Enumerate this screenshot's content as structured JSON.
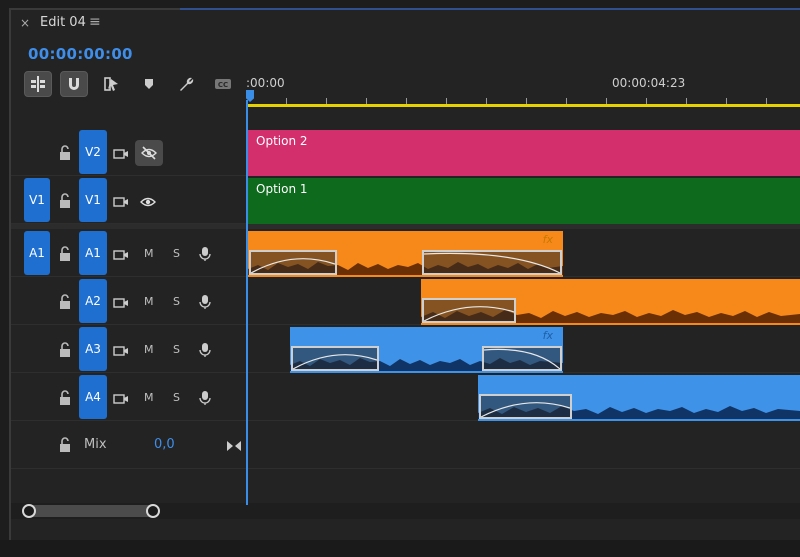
{
  "tab": {
    "close_glyph": "×",
    "title": "Edit 04",
    "menu_glyph": "≡"
  },
  "timecode": "00:00:00:00",
  "toolbar": [
    {
      "name": "insert-sequence-as-nest-icon"
    },
    {
      "name": "snap-magnet-icon"
    },
    {
      "name": "linked-selection-icon"
    },
    {
      "name": "add-marker-icon"
    },
    {
      "name": "wrench-settings-icon"
    },
    {
      "name": "captions-icon"
    }
  ],
  "ruler": {
    "start_label": ":00:00",
    "mid_label": "00:00:04:23"
  },
  "tracks": {
    "v2": {
      "target": "V2"
    },
    "v1": {
      "source": "V1",
      "target": "V1"
    },
    "a1": {
      "source": "A1",
      "target": "A1",
      "mute": "M",
      "solo": "S"
    },
    "a2": {
      "target": "A2",
      "mute": "M",
      "solo": "S"
    },
    "a3": {
      "target": "A3",
      "mute": "M",
      "solo": "S"
    },
    "a4": {
      "target": "A4",
      "mute": "M",
      "solo": "S"
    }
  },
  "clips": {
    "v2": {
      "label": "Option 2",
      "color": "#d32f6d"
    },
    "v1": {
      "label": "Option 1",
      "color": "#0e6b1e"
    },
    "a1": {
      "fx": "fx",
      "color": "#f7881a"
    },
    "a2": {
      "color": "#f7881a"
    },
    "a3": {
      "fx": "fx",
      "color": "#3e93e8"
    },
    "a4": {
      "color": "#3e93e8"
    }
  },
  "mix": {
    "label": "Mix",
    "value": "0,0"
  },
  "colors": {
    "accent": "#3e8eea",
    "playhead": "#3a8ee6",
    "work_area": "#e6d200",
    "track_button": "#1f6fd0"
  }
}
